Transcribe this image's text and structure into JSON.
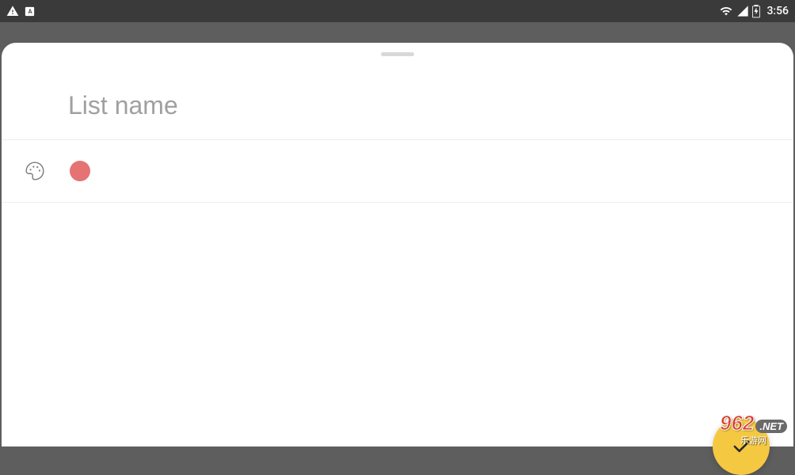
{
  "statusBar": {
    "time": "3:56"
  },
  "sheet": {
    "inputPlaceholder": "List name",
    "inputValue": "",
    "selectedColor": "#e57373"
  },
  "watermark": {
    "badge962": "962",
    "badgeNet": ".NET",
    "subtitle": "乐游网"
  }
}
